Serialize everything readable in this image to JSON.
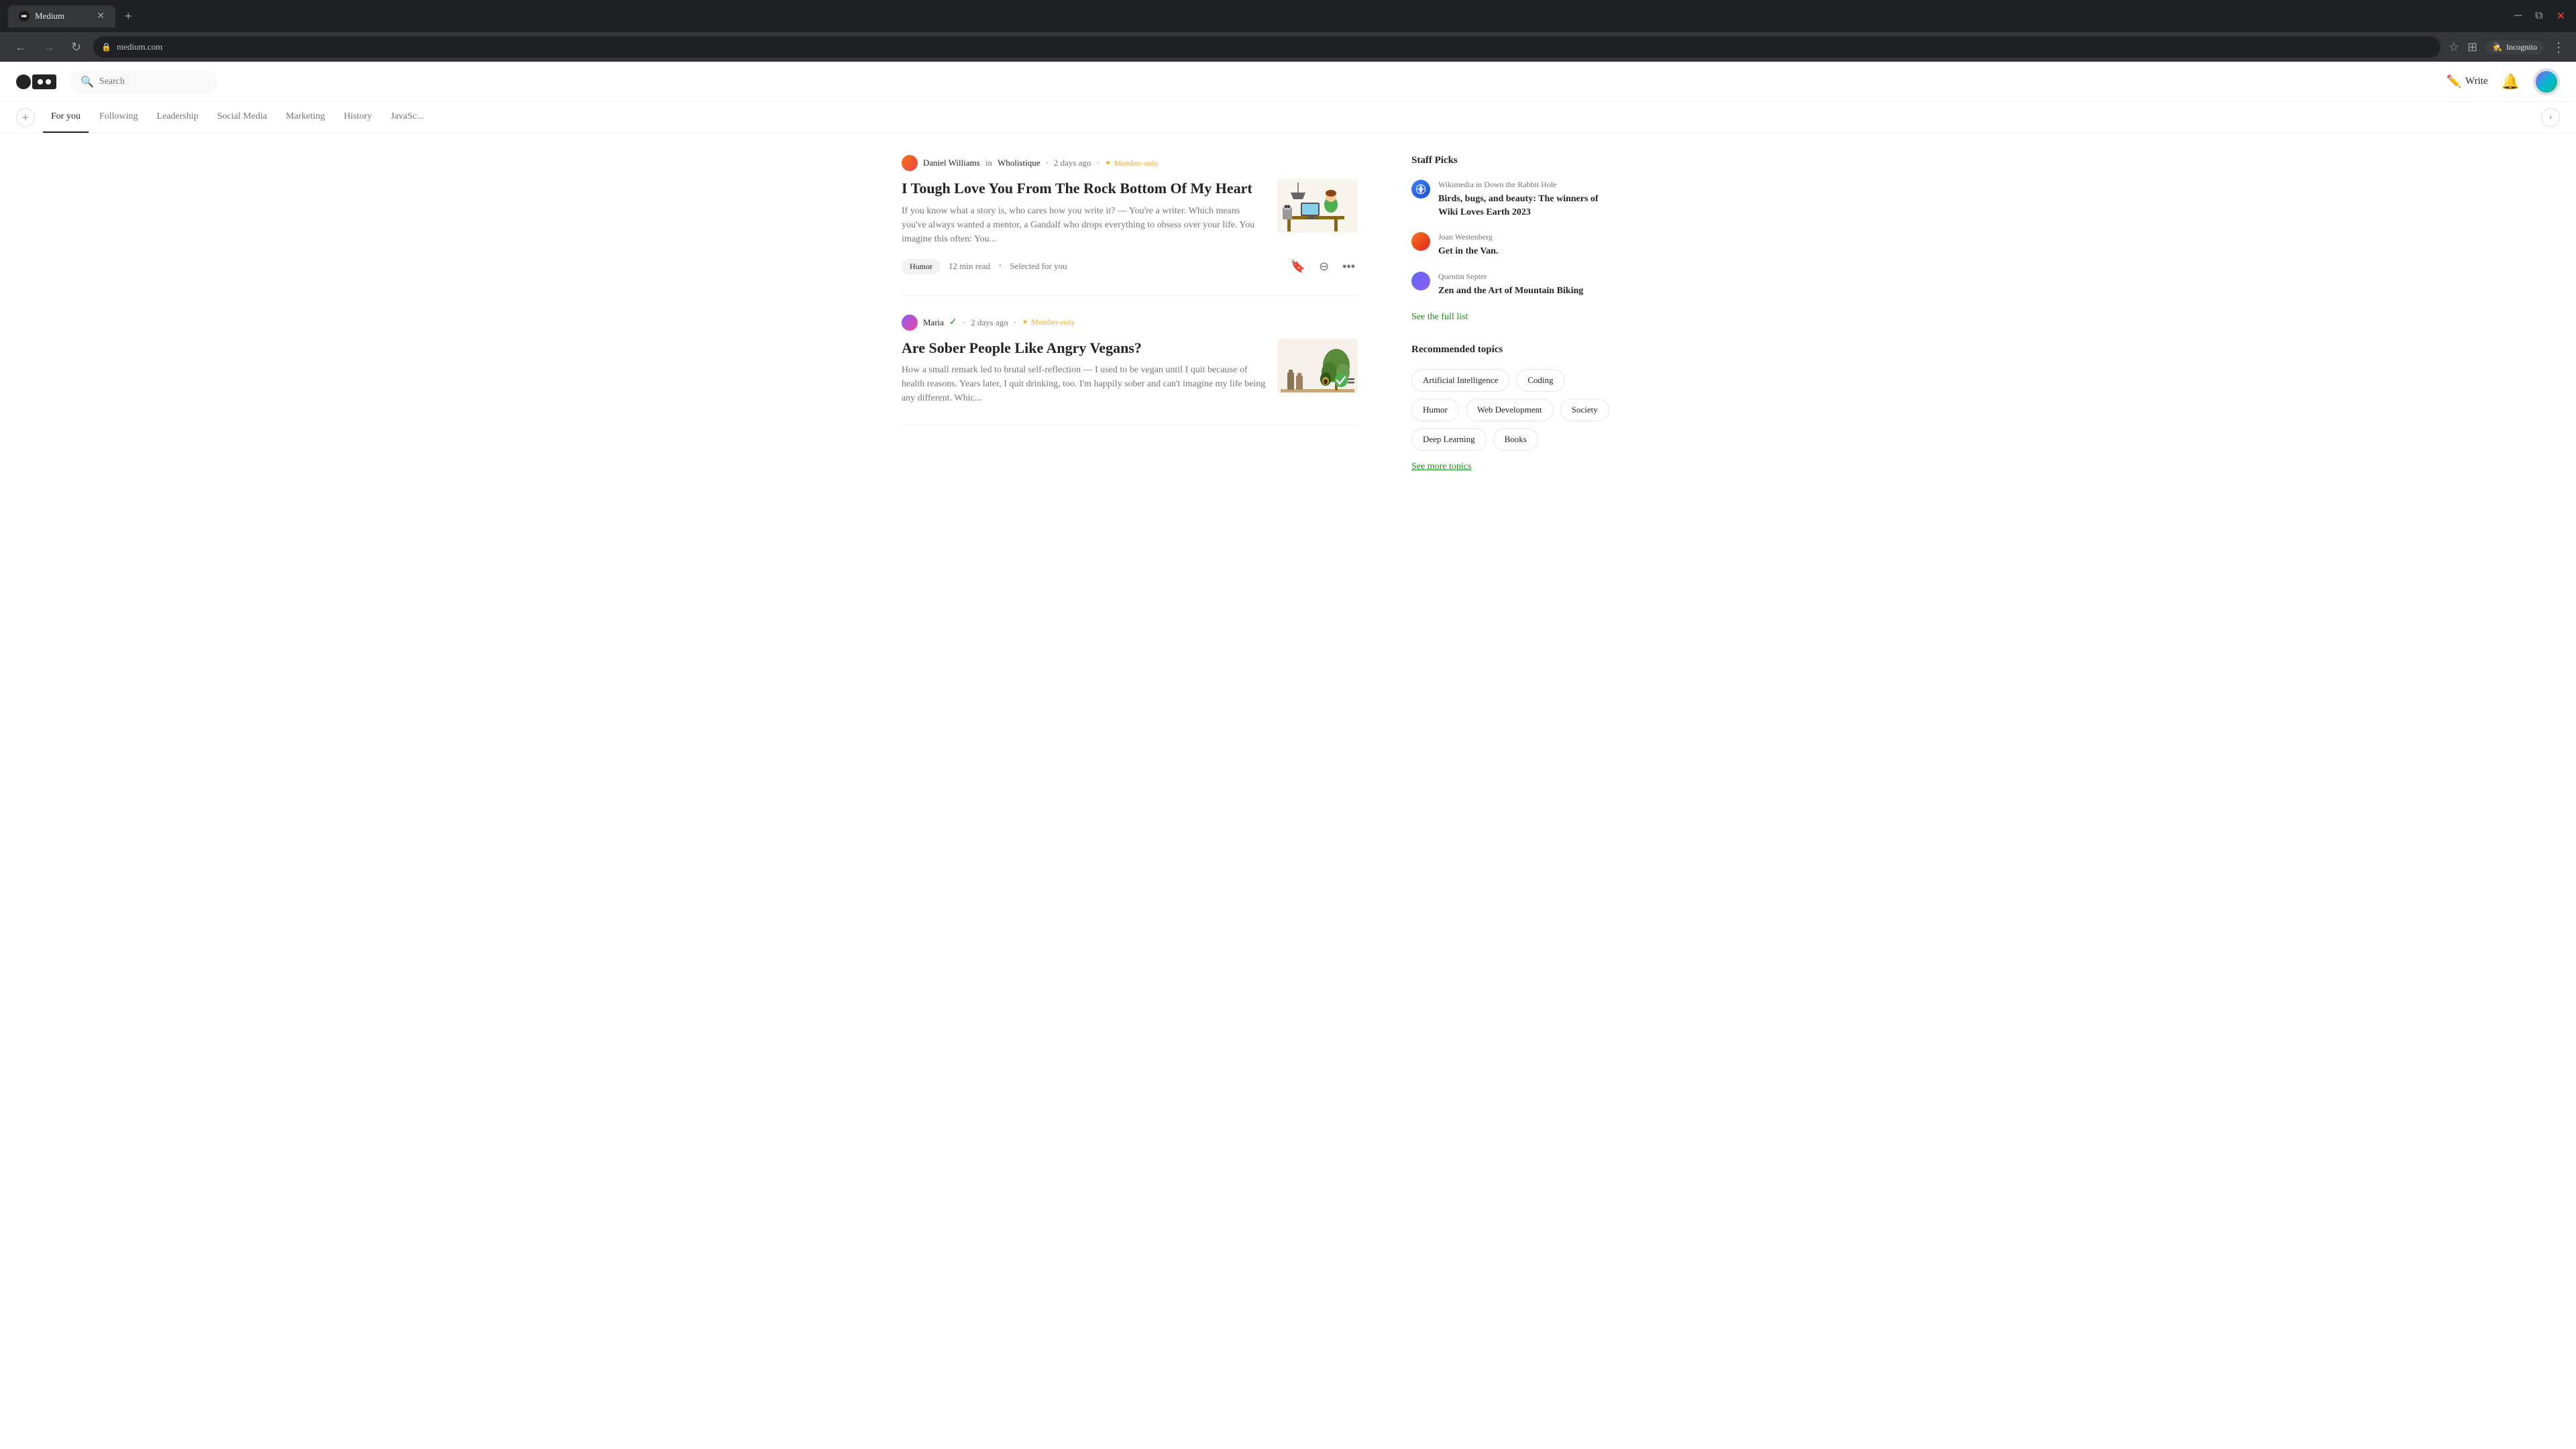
{
  "browser": {
    "tab_title": "Medium",
    "url": "medium.com",
    "tab_new_label": "+",
    "incognito_label": "Incognito"
  },
  "nav": {
    "search_placeholder": "Search",
    "write_label": "Write",
    "logo_alt": "Medium"
  },
  "tabs": [
    {
      "id": "add",
      "label": "+",
      "type": "add"
    },
    {
      "id": "for-you",
      "label": "For you",
      "active": true
    },
    {
      "id": "following",
      "label": "Following"
    },
    {
      "id": "leadership",
      "label": "Leadership"
    },
    {
      "id": "social-media",
      "label": "Social Media"
    },
    {
      "id": "marketing",
      "label": "Marketing"
    },
    {
      "id": "history",
      "label": "History"
    },
    {
      "id": "javascript",
      "label": "JavaSc..."
    }
  ],
  "articles": [
    {
      "id": 1,
      "author": "Daniel Williams",
      "author_pub": "in Wholistique",
      "time_ago": "2 days ago",
      "member_only": true,
      "member_label": "Member-only",
      "title": "I Tough Love You From The Rock Bottom Of My Heart",
      "excerpt": "If you know what a story is, who cares how you write it? — You're a writer. Which means you've always wanted a mentor, a Gandalf who drops everything to obsess over your life. You imagine this often: You...",
      "tag": "Humor",
      "read_time": "12 min read",
      "selected_for": "Selected for you",
      "has_image": true
    },
    {
      "id": 2,
      "author": "Maria",
      "author_pub": "",
      "time_ago": "2 days ago",
      "member_only": true,
      "member_label": "Member-only",
      "verified": true,
      "title": "Are Sober People Like Angry Vegans?",
      "excerpt": "How a small remark led to brutal self-reflection — I used to be vegan until I quit because of health reasons. Years later, I quit drinking, too. I'm happily sober and can't imagine my life being any different. Whic...",
      "tag": "",
      "read_time": "",
      "selected_for": "",
      "has_image": true
    }
  ],
  "sidebar": {
    "staff_picks_title": "Staff Picks",
    "staff_picks": [
      {
        "author": "Wikimedia",
        "pub": "Down the Rabbit Hole",
        "title": "Birds, bugs, and beauty: The winners of Wiki Loves Earth 2023",
        "author_in": "in"
      },
      {
        "author": "Joan Westenberg",
        "pub": "",
        "title": "Get in the Van.",
        "author_in": ""
      },
      {
        "author": "Quentin Septer",
        "pub": "",
        "title": "Zen and the Art of Mountain Biking",
        "author_in": ""
      }
    ],
    "see_full_list": "See the full list",
    "recommended_topics_title": "Recommended topics",
    "topics": [
      "Artificial Intelligence",
      "Coding",
      "Humor",
      "Web Development",
      "Society",
      "Deep Learning",
      "Books"
    ],
    "see_more_topics": "See more topics"
  }
}
